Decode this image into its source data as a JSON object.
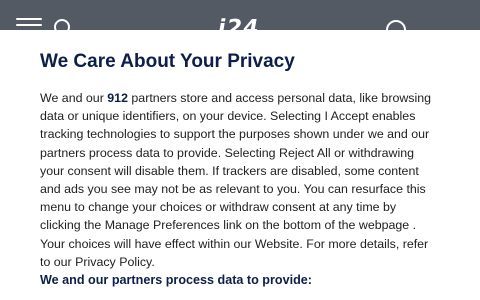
{
  "header": {
    "logo_text": "i24",
    "menu_icon": "hamburger-menu-icon",
    "search_icon": "search-icon",
    "account_icon": "account-icon"
  },
  "consent": {
    "title": "We Care About Your Privacy",
    "body_intro": "We and our ",
    "partner_count": "912",
    "body_rest": " partners store and access personal data, like browsing data or unique identifiers, on your device. Selecting I Accept enables tracking technologies to support the purposes shown under we and our partners process data to provide. Selecting Reject All or withdrawing your consent will disable them. If trackers are disabled, some content and ads you see may not be as relevant to you. You can resurface this menu to change your choices or withdraw consent at any time by clicking the Manage Preferences link on the bottom of the webpage . Your choices will have effect within our Website. For more details, refer to our Privacy Policy.",
    "subheading": "We and our partners process data to provide:"
  },
  "colors": {
    "header_bg": "#545a63",
    "title_color": "#0b1f48",
    "text_color": "#212121"
  }
}
